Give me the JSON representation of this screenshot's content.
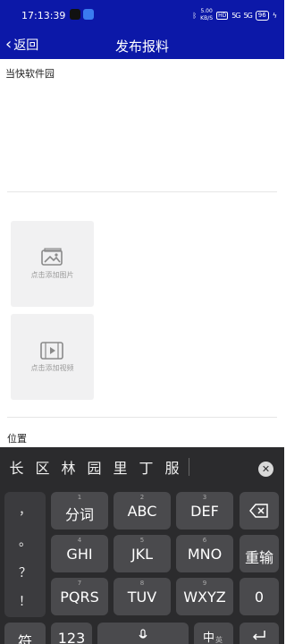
{
  "status_bar": {
    "time": "17:13:39",
    "speed_value": "5.00",
    "speed_unit": "KB/S",
    "hd_badge": "HD",
    "signal_1": "5G",
    "signal_2": "5G",
    "battery": "96"
  },
  "nav": {
    "back_label": "返回",
    "title": "发布报料"
  },
  "form": {
    "text_value": "当快软件园",
    "add_photo_label": "点击添加图片",
    "add_video_label": "点击添加视频",
    "location_label": "位置"
  },
  "keyboard": {
    "candidates": [
      "长",
      "区",
      "林",
      "园",
      "里",
      "丁",
      "服"
    ],
    "punctuation": [
      "，",
      "。",
      "？",
      "！"
    ],
    "keys": {
      "fenci": "分词",
      "abc": "ABC",
      "def": "DEF",
      "ghi": "GHI",
      "jkl": "JKL",
      "mno": "MNO",
      "pqrs": "PQRS",
      "tuv": "TUV",
      "wxyz": "WXYZ",
      "reenter": "重输",
      "zero": "0",
      "symbol": "符",
      "num_mode": "123",
      "lang": "中",
      "lang_sub": "英"
    },
    "key_numbers": {
      "k1": "1",
      "k2": "2",
      "k3": "3",
      "k4": "4",
      "k5": "5",
      "k6": "6",
      "k7": "7",
      "k8": "8",
      "k9": "9"
    }
  }
}
